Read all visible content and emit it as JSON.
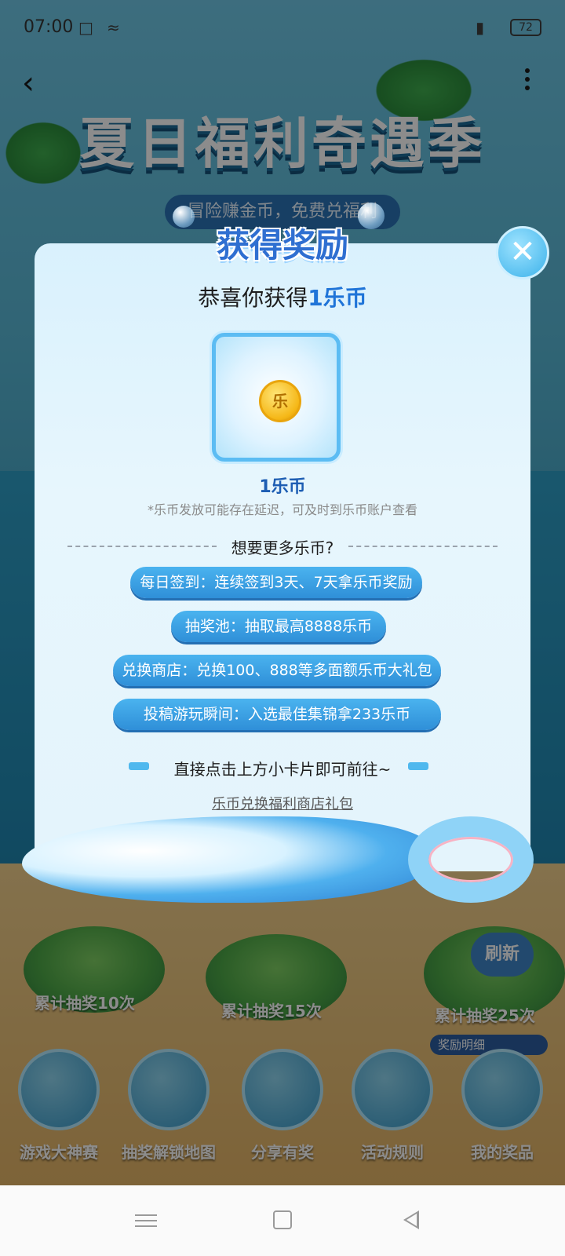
{
  "status_bar": {
    "time": "07:00",
    "battery": "72"
  },
  "banner": {
    "title": "夏日福利奇遇季",
    "subtitle": "冒险赚金币，免费兑福利"
  },
  "modal": {
    "header": "获得奖励",
    "congrats_prefix": "恭喜你获得",
    "congrats_amount": "1乐币",
    "reward_name": "1乐币",
    "coin_glyph": "乐",
    "note": "*乐币发放可能存在延迟，可及时到乐币账户查看",
    "divider_text": "想要更多乐币?",
    "pills": [
      "每日签到：连续签到3天、7天拿乐币奖励",
      "抽奖池：抽取最高8888乐币",
      "兑换商店：兑换100、888等多面额乐币大礼包",
      "投稿游玩瞬间：入选最佳集锦拿233乐币"
    ],
    "goto_text": "直接点击上方小卡片即可前往~",
    "link_text": "乐币兑换福利商店礼包"
  },
  "map": {
    "islands": [
      "累计抽奖10次",
      "累计抽奖15次",
      "累计抽奖25次"
    ],
    "refresh_label": "刷新",
    "prize_pill": "奖励明细"
  },
  "bottom_nav": [
    {
      "label": "游戏大神赛",
      "icon": "tv-icon"
    },
    {
      "label": "抽奖解锁地图",
      "icon": "map-icon"
    },
    {
      "label": "分享有奖",
      "icon": "share-icon"
    },
    {
      "label": "活动规则",
      "icon": "rules-book-icon"
    },
    {
      "label": "我的奖品",
      "icon": "gift-icon"
    }
  ],
  "colors": {
    "accent": "#2f8fd8",
    "amount": "#1f74d8"
  }
}
